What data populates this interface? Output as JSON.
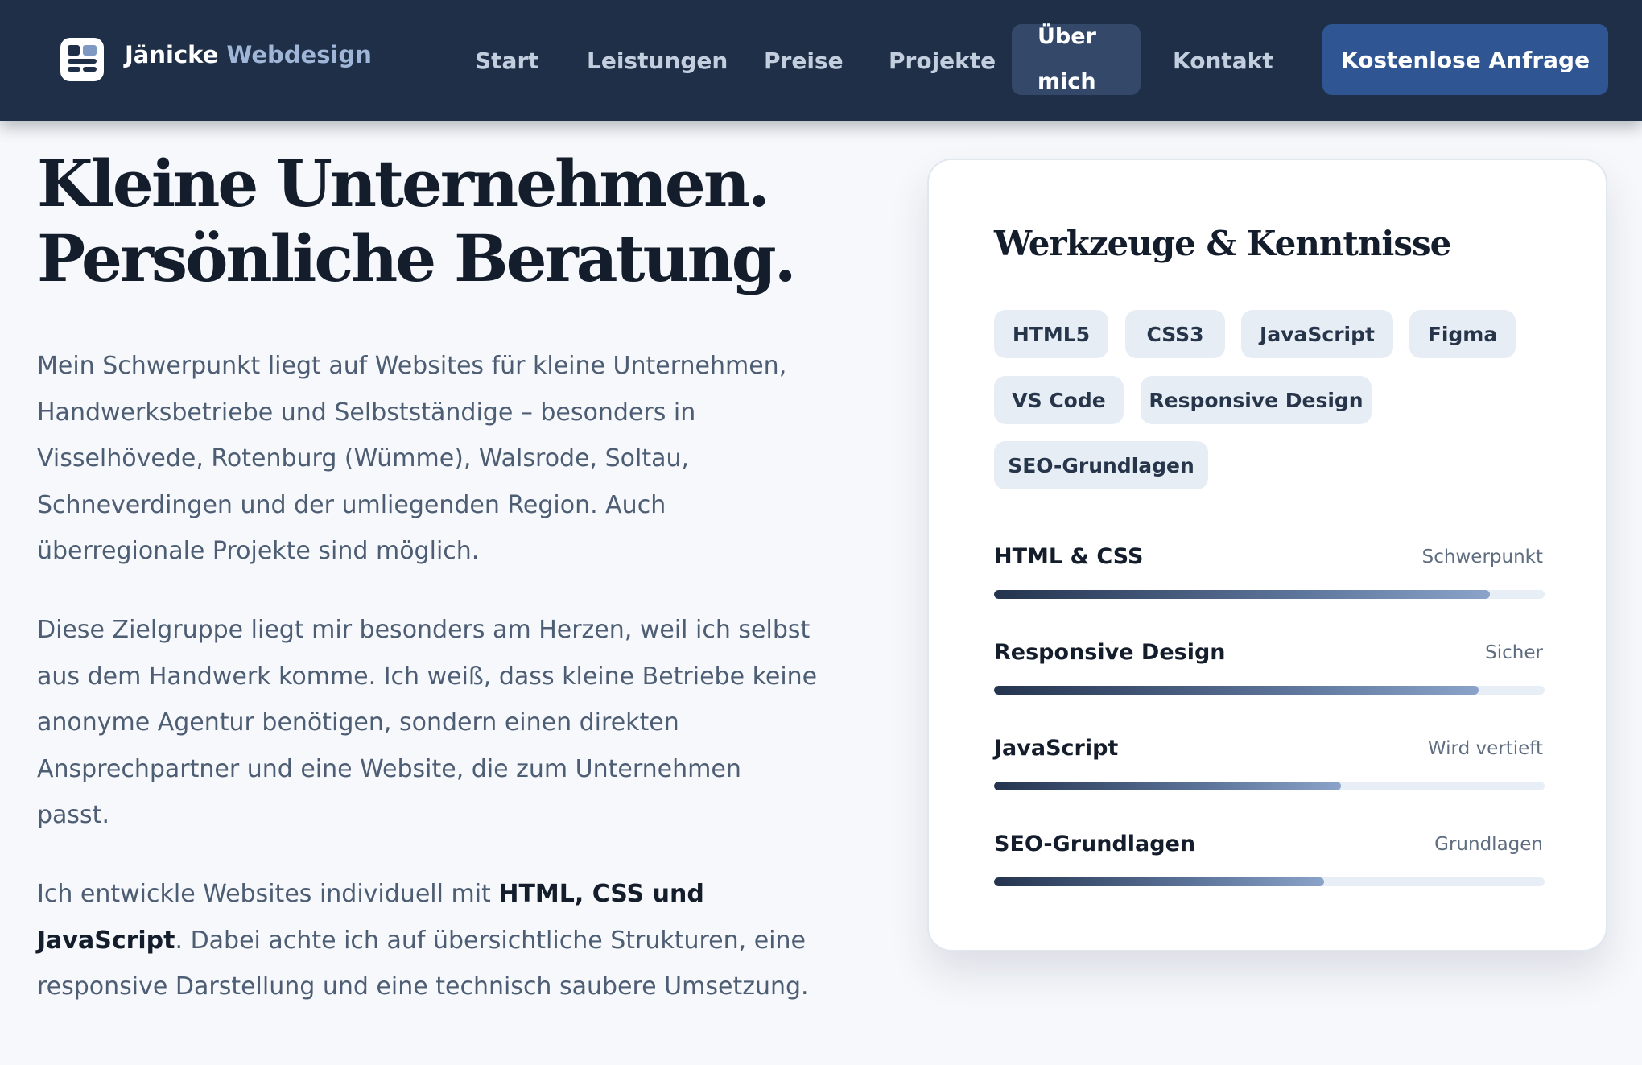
{
  "brand": {
    "name_part1": "Jänicke",
    "name_part2": "Webdesign",
    "accent_color": "#9fb6d8",
    "icon": "layout-icon"
  },
  "nav": {
    "items": [
      {
        "label": "Start"
      },
      {
        "label": "Leistungen"
      },
      {
        "label": "Preise"
      },
      {
        "label": "Projekte"
      },
      {
        "label_line1": "Über",
        "label_line2": "mich",
        "active": true
      },
      {
        "label": "Kontakt"
      }
    ],
    "cta_label": "Kostenlose Anfrage"
  },
  "hero": {
    "title_line1": "Kleine Unternehmen.",
    "title_line2": "Persönliche Beratung."
  },
  "paragraphs": {
    "p1": [
      "Mein Schwerpunkt liegt auf Websites für kleine Unternehmen,",
      "Handwerksbetriebe und Selbstständige – besonders in",
      "Visselhövede, Rotenburg (Wümme), Walsrode, Soltau,",
      "Schneverdingen und der umliegenden Region. Auch",
      "überregionale Projekte sind möglich."
    ],
    "p2": [
      "Diese Zielgruppe liegt mir besonders am Herzen, weil ich selbst",
      "aus dem Handwerk komme. Ich weiß, dass kleine Betriebe keine",
      "anonyme Agentur benötigen, sondern einen direkten",
      "Ansprechpartner und eine Website, die zum Unternehmen",
      "passt."
    ],
    "p3": {
      "line1_text": "Ich entwickle Websites individuell mit ",
      "line1_bold": "HTML, CSS und",
      "line2_bold": "JavaScript",
      "line2_text": ". Dabei achte ich auf übersichtliche Strukturen, eine",
      "line3_text": "responsive Darstellung und eine technisch saubere Umsetzung."
    }
  },
  "card": {
    "title": "Werkzeuge & Kenntnisse",
    "chips": [
      "HTML5",
      "CSS3",
      "JavaScript",
      "Figma",
      "VS Code",
      "Responsive Design",
      "SEO-Grundlagen"
    ],
    "skills": [
      {
        "label": "HTML & CSS",
        "level": "Schwerpunkt",
        "progress": 0.9
      },
      {
        "label": "Responsive Design",
        "level": "Sicher",
        "progress": 0.88
      },
      {
        "label": "JavaScript",
        "level": "Wird vertieft",
        "progress": 0.63
      },
      {
        "label": "SEO-Grundlagen",
        "level": "Grundlagen",
        "progress": 0.6
      }
    ]
  }
}
